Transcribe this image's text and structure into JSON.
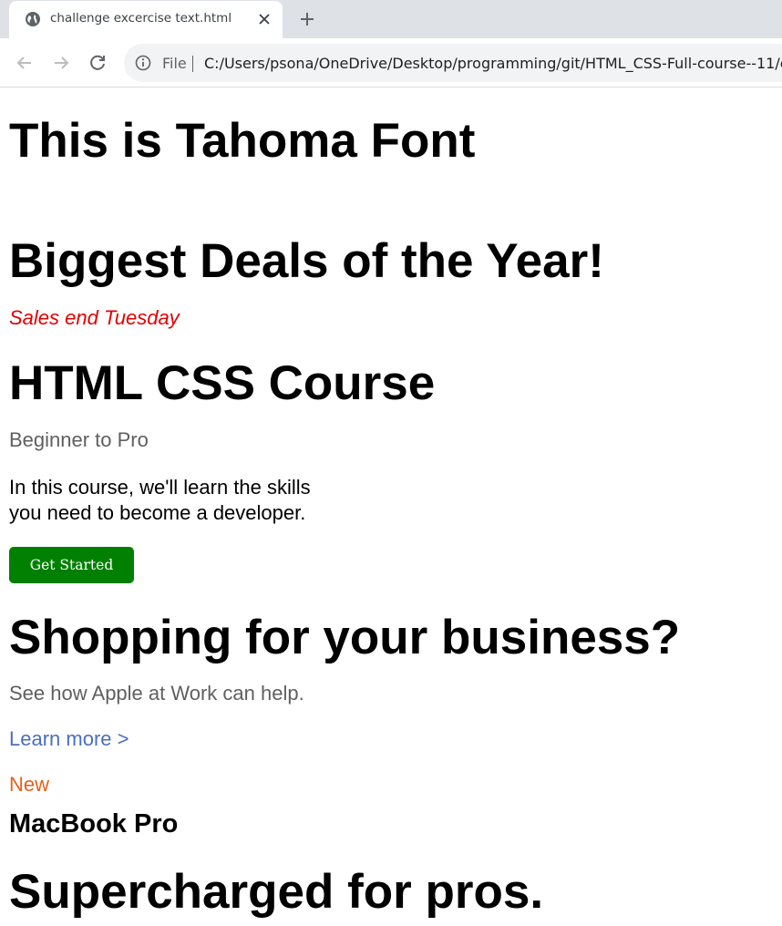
{
  "browser": {
    "tab": {
      "title": "challenge excercise text.html",
      "favicon": "globe-icon",
      "close_icon": "close-icon"
    },
    "new_tab_icon": "plus-icon",
    "toolbar": {
      "back_icon": "arrow-left-icon",
      "forward_icon": "arrow-right-icon",
      "reload_icon": "reload-icon",
      "info_icon": "info-icon",
      "scheme_label": "File",
      "url": "C:/Users/psona/OneDrive/Desktop/programming/git/HTML_CSS-Full-course--11/c"
    }
  },
  "page": {
    "heading_tahoma": "This is Tahoma Font",
    "heading_deals": "Biggest Deals of the Year!",
    "sale_note": "Sales end Tuesday",
    "heading_course": "HTML CSS Course",
    "course_subtitle": "Beginner to Pro",
    "course_description": "In this course, we'll learn the skills you need to become a developer.",
    "cta_label": "Get Started",
    "heading_shopping": "Shopping for your business?",
    "shopping_subtitle": "See how Apple at Work can help.",
    "learn_more_link": "Learn more >",
    "new_badge": "New",
    "product_name": "MacBook Pro",
    "heading_supercharged": "Supercharged for pros."
  },
  "colors": {
    "sale_note": "#e30000",
    "cta_background": "#008000",
    "link": "#4a6fbf",
    "new_badge": "#e4611a",
    "subtitle_gray": "#5f5f5f"
  }
}
